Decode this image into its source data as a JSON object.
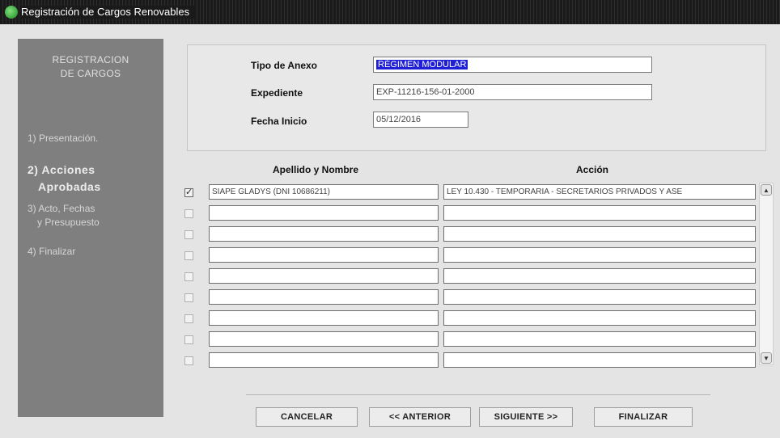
{
  "window": {
    "title": "Registración de Cargos Renovables"
  },
  "sidebar": {
    "title_lines": [
      "REGISTRACION",
      "DE CARGOS"
    ],
    "steps": [
      {
        "lines": [
          "1) Presentación."
        ]
      },
      {
        "lines": [
          "2) Acciones",
          "Aprobadas"
        ]
      },
      {
        "lines": [
          "3) Acto, Fechas",
          "y Presupuesto"
        ]
      },
      {
        "lines": [
          "4) Finalizar"
        ]
      }
    ]
  },
  "form": {
    "tipo_label": "Tipo de Anexo",
    "tipo_value": "RÉGIMEN MODULAR",
    "expediente_label": "Expediente",
    "expediente_value": "EXP-11216-156-01-2000",
    "fecha_label": "Fecha Inicio",
    "fecha_value": "05/12/2016"
  },
  "table": {
    "headers": [
      "Apellido y Nombre",
      "Acción"
    ],
    "rows": [
      {
        "checked": true,
        "nombre": "SIAPE GLADYS (DNI 10686211)",
        "accion": "LEY 10.430 - TEMPORARIA - SECRETARIOS PRIVADOS Y ASE"
      },
      {
        "checked": false,
        "nombre": "",
        "accion": ""
      },
      {
        "checked": false,
        "nombre": "",
        "accion": ""
      },
      {
        "checked": false,
        "nombre": "",
        "accion": ""
      },
      {
        "checked": false,
        "nombre": "",
        "accion": ""
      },
      {
        "checked": false,
        "nombre": "",
        "accion": ""
      },
      {
        "checked": false,
        "nombre": "",
        "accion": ""
      },
      {
        "checked": false,
        "nombre": "",
        "accion": ""
      },
      {
        "checked": false,
        "nombre": "",
        "accion": ""
      }
    ]
  },
  "buttons": {
    "cancel": "CANCELAR",
    "back": "<< ANTERIOR",
    "next": "SIGUIENTE >>",
    "finish": "FINALIZAR"
  },
  "colors": {
    "selection": "#1f1fd8",
    "sidebar": "#7f7f7f",
    "titlebar": "#1a1a1a"
  },
  "icons": {
    "app": "app-leaf-icon",
    "scroll_up": "arrow-up-icon",
    "scroll_down": "arrow-down-icon",
    "check": "checkmark-icon"
  }
}
